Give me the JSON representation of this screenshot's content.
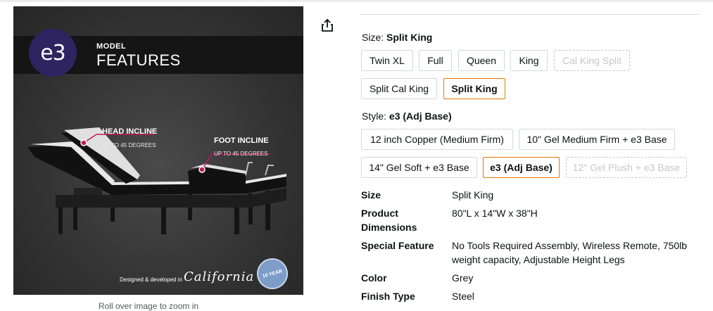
{
  "image": {
    "badge": "e3",
    "model_label": "MODEL",
    "features_label": "FEATURES",
    "head_incline_title": "HEAD INCLINE",
    "head_incline_sub": "UP TO 45 DEGREES",
    "foot_incline_title": "FOOT INCLINE",
    "foot_incline_sub": "UP TO 45 DEGREES",
    "footer_text": "Designed & developed in",
    "footer_script": "California",
    "warranty_badge": "10 YEAR",
    "caption": "Roll over image to zoom in"
  },
  "size": {
    "label": "Size:",
    "selected": "Split King",
    "options": [
      "Twin XL",
      "Full",
      "Queen",
      "King",
      "Cal King Split",
      "Split Cal King",
      "Split King"
    ]
  },
  "style": {
    "label": "Style:",
    "selected": "e3 (Adj Base)",
    "options": [
      "12 inch Copper (Medium Firm)",
      "10\" Gel Medium Firm + e3 Base",
      "14\" Gel Soft + e3 Base",
      "e3 (Adj Base)",
      "12\" Gel Plush + e3 Base"
    ]
  },
  "specs": [
    {
      "key": "Size",
      "value": "Split King"
    },
    {
      "key": "Product Dimensions",
      "value": "80\"L x 14\"W x 38\"H"
    },
    {
      "key": "Special Feature",
      "value": "No Tools Required Assembly, Wireless Remote, 750lb weight capacity, Adjustable Height Legs"
    },
    {
      "key": "Color",
      "value": "Grey"
    },
    {
      "key": "Finish Type",
      "value": "Steel"
    }
  ],
  "icons": {
    "share": "share-icon"
  },
  "colors": {
    "selected_border": "#e77600",
    "badge_bg": "#2e2461",
    "callout_accent": "#c2185b"
  }
}
